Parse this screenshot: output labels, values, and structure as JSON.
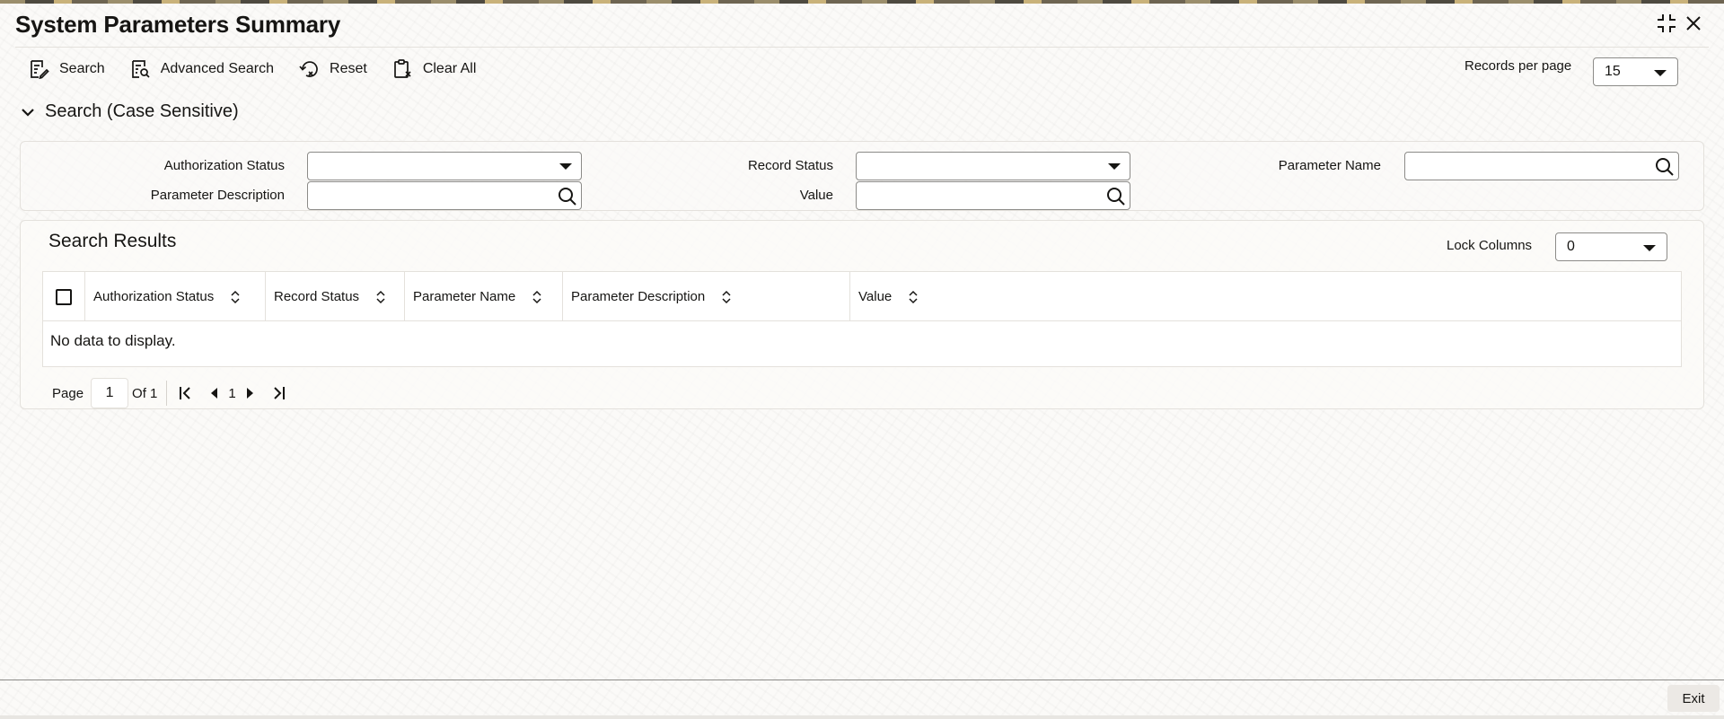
{
  "window": {
    "title": "System Parameters Summary",
    "icons": {
      "maximize": "expand-icon",
      "close": "close-icon"
    }
  },
  "toolbar": {
    "search_label": "Search",
    "advanced_search_label": "Advanced Search",
    "reset_label": "Reset",
    "clear_all_label": "Clear All"
  },
  "records_per_page": {
    "label": "Records per page",
    "value": "15"
  },
  "search_section": {
    "title": "Search (Case Sensitive)",
    "fields": {
      "authorization_status": {
        "label": "Authorization Status",
        "value": ""
      },
      "record_status": {
        "label": "Record Status",
        "value": ""
      },
      "parameter_name": {
        "label": "Parameter Name",
        "value": ""
      },
      "parameter_description": {
        "label": "Parameter Description",
        "value": ""
      },
      "value": {
        "label": "Value",
        "value": ""
      }
    }
  },
  "results": {
    "title": "Search Results",
    "lock_columns": {
      "label": "Lock Columns",
      "value": "0"
    },
    "columns": [
      "Authorization Status",
      "Record Status",
      "Parameter Name",
      "Parameter Description",
      "Value"
    ],
    "empty_message": "No data to display."
  },
  "pagination": {
    "page_label": "Page",
    "current_page": "1",
    "of_label": "Of 1",
    "page_number": "1"
  },
  "footer": {
    "exit_label": "Exit"
  }
}
